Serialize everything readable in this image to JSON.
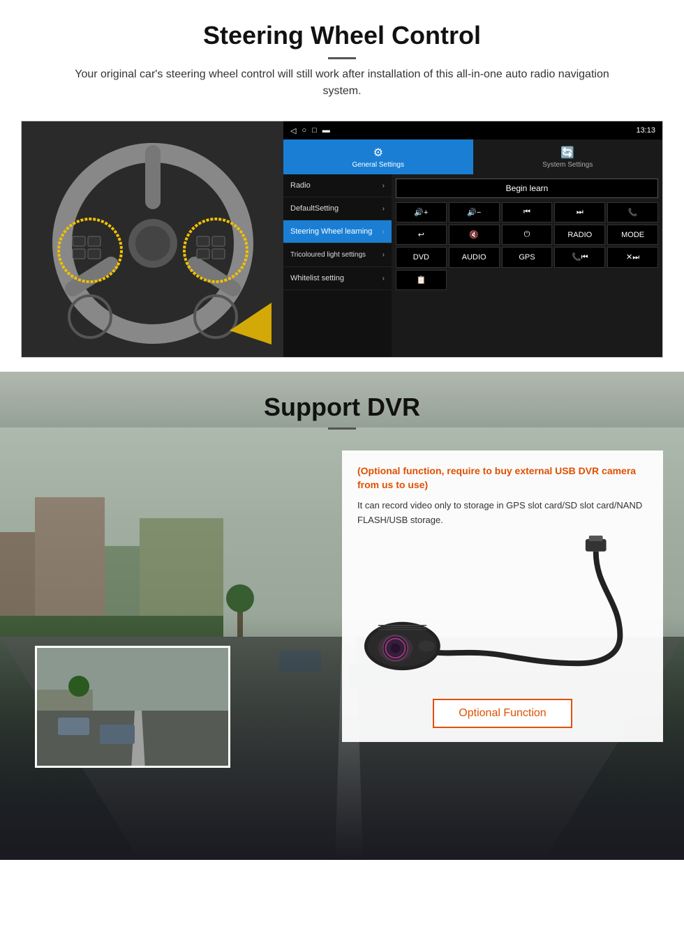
{
  "steering": {
    "title": "Steering Wheel Control",
    "description": "Your original car's steering wheel control will still work after installation of this all-in-one auto radio navigation system.",
    "statusbar": {
      "time": "13:13",
      "nav_buttons": [
        "◁",
        "○",
        "□",
        "▬"
      ]
    },
    "tabs": [
      {
        "label": "General Settings",
        "icon": "⚙",
        "active": true
      },
      {
        "label": "System Settings",
        "icon": "🔄",
        "active": false
      }
    ],
    "menu_items": [
      {
        "label": "Radio",
        "active": false
      },
      {
        "label": "DefaultSetting",
        "active": false
      },
      {
        "label": "Steering Wheel learning",
        "active": true
      },
      {
        "label": "Tricoloured light settings",
        "active": false
      },
      {
        "label": "Whitelist setting",
        "active": false
      }
    ],
    "begin_learn": "Begin learn",
    "control_buttons": [
      "🔊+",
      "🔊−",
      "⏮",
      "⏭",
      "📞",
      "↩",
      "🔊✕",
      "⏻",
      "RADIO",
      "MODE",
      "DVD",
      "AUDIO",
      "GPS",
      "📞⏮",
      "✕⏭",
      "📋"
    ]
  },
  "dvr": {
    "title": "Support DVR",
    "optional_text": "(Optional function, require to buy external USB DVR camera from us to use)",
    "description": "It can record video only to storage in GPS slot card/SD slot card/NAND FLASH/USB storage.",
    "optional_btn": "Optional Function"
  }
}
